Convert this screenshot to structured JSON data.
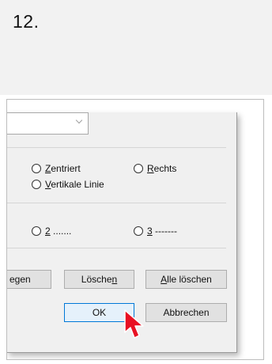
{
  "step": {
    "number": "12."
  },
  "dialog": {
    "alignment_options": {
      "centered": {
        "accel": "Z",
        "rest": "entriert"
      },
      "right": {
        "accel": "R",
        "rest": "echts"
      },
      "vertical_line": {
        "accel": "V",
        "rest": "ertikale Linie"
      }
    },
    "leader_options": {
      "option2": {
        "accel": "2",
        "rest": " ......."
      },
      "option3": {
        "accel": "3",
        "rest": " -------"
      }
    },
    "buttons": {
      "set_partial": "egen",
      "delete": {
        "prefix": "Lösche",
        "accel": "n"
      },
      "delete_all": {
        "accel": "A",
        "rest": "lle löschen"
      },
      "ok": "OK",
      "cancel": "Abbrechen"
    }
  },
  "cursor": {
    "icon": "mouse-pointer-icon",
    "color": "#e81123"
  }
}
